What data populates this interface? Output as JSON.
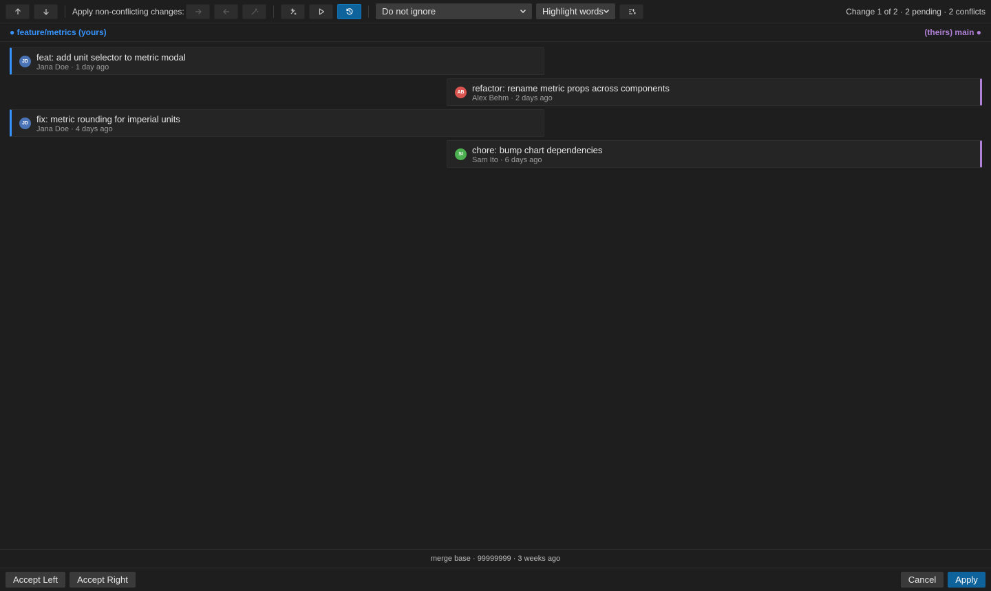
{
  "toolbar": {
    "prev_icon": "arrow-up-icon",
    "next_icon": "arrow-down-icon",
    "apply_label": "Apply non-conflicting changes:",
    "apply_left_icon": "arrow-right-icon",
    "apply_right_icon": "arrow-left-icon",
    "apply_all_icon": "magic-wand-icon",
    "auto_resolve_icon": "sparkle-wand-icon",
    "run_icon": "play-icon",
    "history_icon": "history-icon",
    "whitespace_select": {
      "value": "Do not ignore"
    },
    "highlight_select": {
      "value": "Highlight words"
    },
    "settings_icon": "toggle-settings-icon",
    "status": "Change 1 of 2 · 2 pending · 2 conflicts"
  },
  "branches": {
    "left": "● feature/metrics (yours)",
    "right": "(theirs) main ●"
  },
  "commits": [
    {
      "side": "left",
      "initials": "JD",
      "avatar_color": "#4a74b5",
      "title": "feat: add unit selector to metric modal",
      "meta": "Jana Doe · 1 day ago"
    },
    {
      "side": "right",
      "initials": "AB",
      "avatar_color": "#d9534f",
      "title": "refactor: rename metric props across components",
      "meta": "Alex Behm · 2 days ago"
    },
    {
      "side": "left",
      "initials": "JD",
      "avatar_color": "#4a74b5",
      "title": "fix: metric rounding for imperial units",
      "meta": "Jana Doe · 4 days ago"
    },
    {
      "side": "right",
      "initials": "SI",
      "avatar_color": "#4caf50",
      "title": "chore: bump chart dependencies",
      "meta": "Sam Ito · 6 days ago"
    }
  ],
  "merge_base": "merge base · 99999999 · 3 weeks ago",
  "footer": {
    "accept_left": "Accept Left",
    "accept_right": "Accept Right",
    "cancel": "Cancel",
    "apply": "Apply"
  },
  "colors": {
    "accent": "#0e639c",
    "yours": "#3794ff",
    "theirs": "#b180d7"
  }
}
